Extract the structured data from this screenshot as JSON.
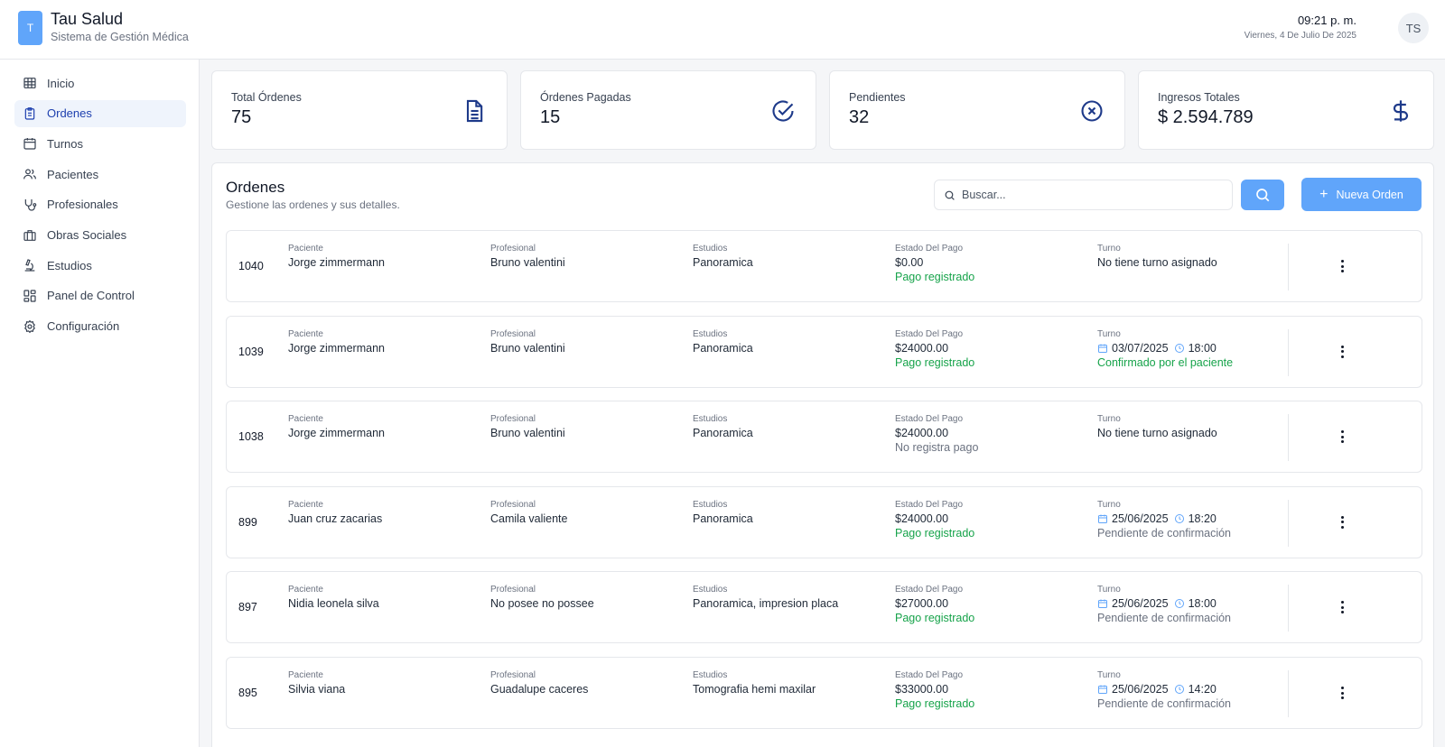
{
  "header": {
    "logo_letter": "T",
    "title": "Tau Salud",
    "subtitle": "Sistema de Gestión Médica",
    "time": "09:21 p. m.",
    "date": "Viernes, 4 De Julio De 2025",
    "avatar": "TS"
  },
  "sidebar": {
    "items": [
      {
        "label": "Inicio",
        "icon": "grid-icon"
      },
      {
        "label": "Ordenes",
        "icon": "clipboard-icon",
        "active": true
      },
      {
        "label": "Turnos",
        "icon": "calendar-icon"
      },
      {
        "label": "Pacientes",
        "icon": "users-icon"
      },
      {
        "label": "Profesionales",
        "icon": "stethoscope-icon"
      },
      {
        "label": "Obras Sociales",
        "icon": "briefcase-icon"
      },
      {
        "label": "Estudios",
        "icon": "microscope-icon"
      },
      {
        "label": "Panel de Control",
        "icon": "dashboard-icon"
      },
      {
        "label": "Configuración",
        "icon": "gear-icon"
      }
    ]
  },
  "stats": [
    {
      "label": "Total Órdenes",
      "value": "75",
      "icon": "document-icon"
    },
    {
      "label": "Órdenes Pagadas",
      "value": "15",
      "icon": "check-circle-icon"
    },
    {
      "label": "Pendientes",
      "value": "32",
      "icon": "x-circle-icon"
    },
    {
      "label": "Ingresos Totales",
      "value": "$ 2.594.789",
      "icon": "dollar-icon"
    }
  ],
  "panel": {
    "title": "Ordenes",
    "subtitle": "Gestione las ordenes y sus detalles.",
    "search_placeholder": "Buscar...",
    "new_button": "Nueva Orden"
  },
  "columns": {
    "paciente": "Paciente",
    "profesional": "Profesional",
    "estudios": "Estudios",
    "estado": "Estado Del Pago",
    "turno": "Turno"
  },
  "colors": {
    "accent": "#60a5fa",
    "icon_navy": "#1e3a8a",
    "success": "#16a34a"
  },
  "orders": [
    {
      "id": "1040",
      "paciente": "Jorge zimmermann",
      "profesional": "Bruno valentini",
      "estudios": "Panoramica",
      "monto": "$0.00",
      "pago": "Pago registrado",
      "pago_ok": true,
      "turno_none": "No tiene turno asignado"
    },
    {
      "id": "1039",
      "paciente": "Jorge zimmermann",
      "profesional": "Bruno valentini",
      "estudios": "Panoramica",
      "monto": "$24000.00",
      "pago": "Pago registrado",
      "pago_ok": true,
      "fecha": "03/07/2025",
      "hora": "18:00",
      "turno_estado": "Confirmado por el paciente",
      "turno_ok": true
    },
    {
      "id": "1038",
      "paciente": "Jorge zimmermann",
      "profesional": "Bruno valentini",
      "estudios": "Panoramica",
      "monto": "$24000.00",
      "pago": "No registra pago",
      "pago_ok": false,
      "turno_none": "No tiene turno asignado"
    },
    {
      "id": "899",
      "paciente": "Juan cruz zacarias",
      "profesional": "Camila valiente",
      "estudios": "Panoramica",
      "monto": "$24000.00",
      "pago": "Pago registrado",
      "pago_ok": true,
      "fecha": "25/06/2025",
      "hora": "18:20",
      "turno_estado": "Pendiente de confirmación",
      "turno_ok": false
    },
    {
      "id": "897",
      "paciente": "Nidia leonela silva",
      "profesional": "No posee no possee",
      "estudios": "Panoramica, impresion placa",
      "monto": "$27000.00",
      "pago": "Pago registrado",
      "pago_ok": true,
      "fecha": "25/06/2025",
      "hora": "18:00",
      "turno_estado": "Pendiente de confirmación",
      "turno_ok": false
    },
    {
      "id": "895",
      "paciente": "Silvia viana",
      "profesional": "Guadalupe caceres",
      "estudios": "Tomografia hemi maxilar",
      "monto": "$33000.00",
      "pago": "Pago registrado",
      "pago_ok": true,
      "fecha": "25/06/2025",
      "hora": "14:20",
      "turno_estado": "Pendiente de confirmación",
      "turno_ok": false
    }
  ]
}
